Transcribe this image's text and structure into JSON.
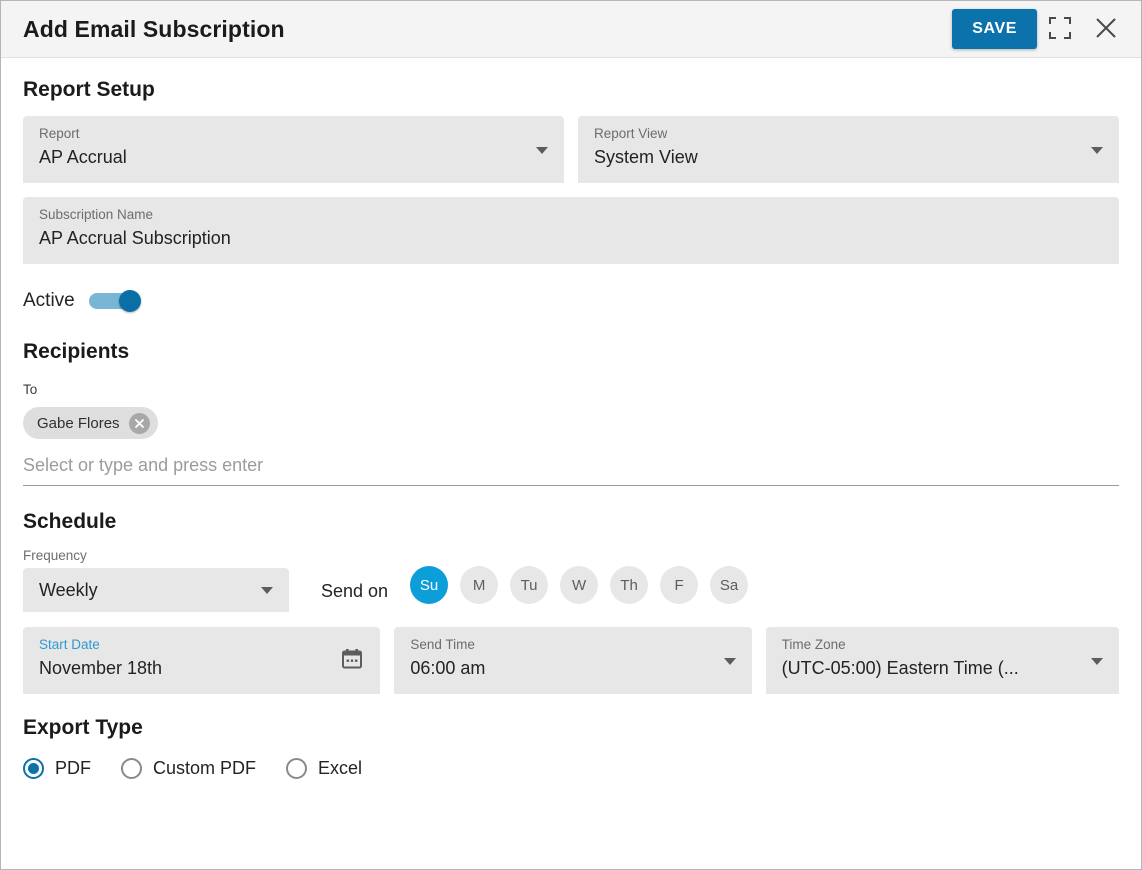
{
  "header": {
    "title": "Add Email Subscription",
    "save_label": "SAVE",
    "expand_icon": "expand-icon",
    "close_icon": "close-icon",
    "accent_color": "#0b72ab"
  },
  "report_setup": {
    "section_title": "Report Setup",
    "report": {
      "label": "Report",
      "value": "AP Accrual"
    },
    "report_view": {
      "label": "Report View",
      "value": "System View"
    },
    "subscription_name": {
      "label": "Subscription Name",
      "value": "AP Accrual Subscription"
    },
    "active": {
      "label": "Active",
      "state": "on"
    }
  },
  "recipients": {
    "section_title": "Recipients",
    "to_label": "To",
    "chips": [
      {
        "name": "Gabe Flores",
        "remove_icon": "close-circle-icon"
      }
    ],
    "input_placeholder": "Select or type and press enter"
  },
  "schedule": {
    "section_title": "Schedule",
    "frequency": {
      "label": "Frequency",
      "value": "Weekly"
    },
    "send_on_label": "Send on",
    "days": [
      {
        "label": "Su",
        "selected": true
      },
      {
        "label": "M",
        "selected": false
      },
      {
        "label": "Tu",
        "selected": false
      },
      {
        "label": "W",
        "selected": false
      },
      {
        "label": "Th",
        "selected": false
      },
      {
        "label": "F",
        "selected": false
      },
      {
        "label": "Sa",
        "selected": false
      }
    ],
    "selected_day_color": "#0c9ed8",
    "start_date": {
      "label": "Start Date",
      "value": "November 18th",
      "icon": "calendar-icon",
      "focused": true
    },
    "send_time": {
      "label": "Send Time",
      "value": "06:00 am"
    },
    "time_zone": {
      "label": "Time Zone",
      "value": "(UTC-05:00) Eastern Time (..."
    }
  },
  "export_type": {
    "section_title": "Export Type",
    "options": [
      {
        "label": "PDF",
        "selected": true
      },
      {
        "label": "Custom PDF",
        "selected": false
      },
      {
        "label": "Excel",
        "selected": false
      }
    ]
  }
}
